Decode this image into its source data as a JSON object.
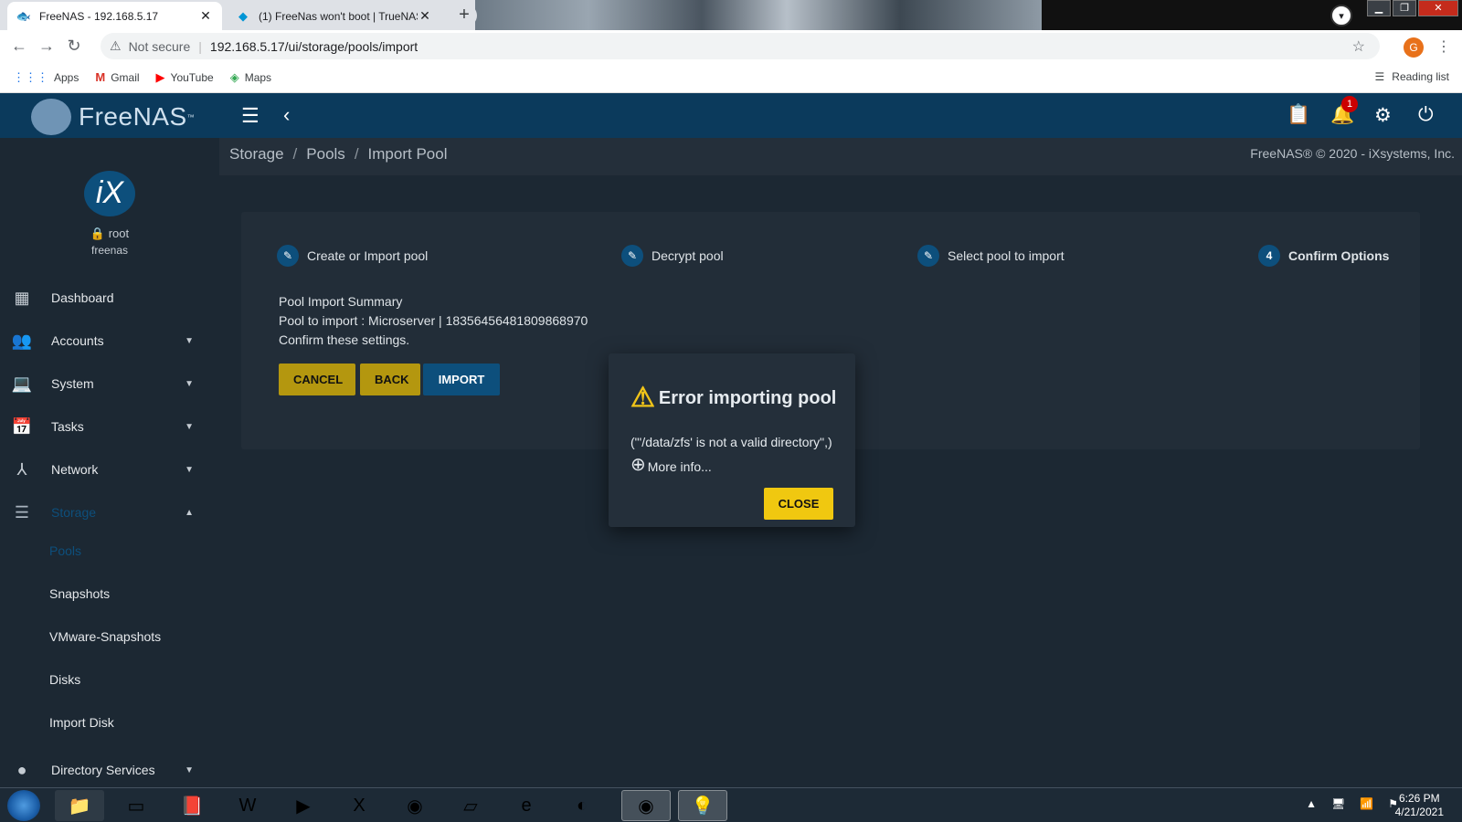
{
  "browser": {
    "tabs": [
      {
        "title": "FreeNAS - 192.168.5.17",
        "active": true
      },
      {
        "title": "(1) FreeNas won't boot | TrueNAS",
        "active": false
      }
    ],
    "new_tab_label": "+",
    "nav": {
      "back": "←",
      "forward": "→",
      "reload": "↻"
    },
    "security_label": "Not secure",
    "url": "192.168.5.17/ui/storage/pools/import",
    "profile_initial": "G",
    "bookmarks": [
      {
        "label": "Apps",
        "icon": "apps-grid-icon"
      },
      {
        "label": "Gmail",
        "icon": "gmail-icon"
      },
      {
        "label": "YouTube",
        "icon": "youtube-icon"
      },
      {
        "label": "Maps",
        "icon": "maps-icon"
      }
    ],
    "reading_list_label": "Reading list"
  },
  "app": {
    "logo_text": "FreeNAS",
    "logo_tm": "™",
    "notification_count": "1",
    "user": {
      "name": "root",
      "host": "freenas",
      "logo_text": "iX"
    },
    "sidebar": {
      "items": [
        {
          "label": "Dashboard",
          "icon": "dashboard-icon",
          "has_caret": false
        },
        {
          "label": "Accounts",
          "icon": "people-icon",
          "has_caret": true
        },
        {
          "label": "System",
          "icon": "laptop-icon",
          "has_caret": true
        },
        {
          "label": "Tasks",
          "icon": "calendar-icon",
          "has_caret": true
        },
        {
          "label": "Network",
          "icon": "network-icon",
          "has_caret": true
        },
        {
          "label": "Storage",
          "icon": "storage-icon",
          "has_caret": true,
          "active": true
        }
      ],
      "storage_sub": [
        {
          "label": "Pools",
          "active": true
        },
        {
          "label": "Snapshots"
        },
        {
          "label": "VMware-Snapshots"
        },
        {
          "label": "Disks"
        },
        {
          "label": "Import Disk"
        }
      ],
      "partial_item": {
        "label": "Directory Services",
        "icon": "directory-icon"
      }
    },
    "breadcrumb": [
      "Storage",
      "Pools",
      "Import Pool"
    ],
    "breadcrumb_separator": "/",
    "copyright": "FreeNAS® © 2020 - iXsystems, Inc.",
    "stepper": [
      {
        "label": "Create or Import pool",
        "icon": "edit-pencil-icon"
      },
      {
        "label": "Decrypt pool",
        "icon": "edit-pencil-icon"
      },
      {
        "label": "Select pool to import",
        "icon": "edit-pencil-icon"
      },
      {
        "label": "Confirm Options",
        "number": "4"
      }
    ],
    "summary": {
      "title": "Pool Import Summary",
      "pool_line": "Pool to import : Microserver | 18356456481809868970",
      "confirm": "Confirm these settings."
    },
    "buttons": {
      "cancel": "CANCEL",
      "back": "BACK",
      "import": "IMPORT"
    }
  },
  "dialog": {
    "title": "Error importing pool",
    "message": "(\"'/data/zfs' is not a valid directory\",)",
    "more_info": "More info...",
    "close": "CLOSE"
  },
  "taskbar": {
    "time": "6:26 PM",
    "date": "4/21/2021"
  }
}
